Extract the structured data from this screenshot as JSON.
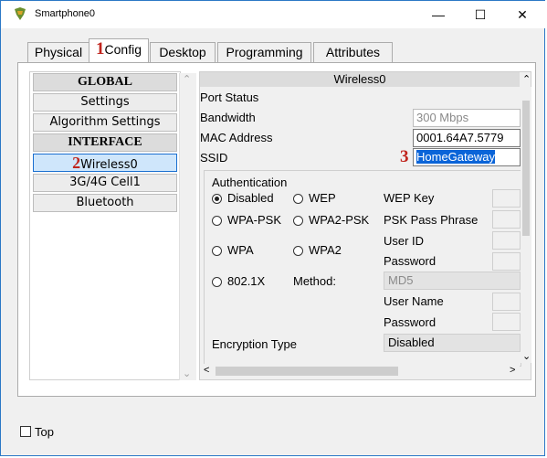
{
  "window": {
    "title": "Smartphone0",
    "minimize": "—",
    "maximize": "☐",
    "close": "✕"
  },
  "tabs": [
    "Physical",
    "Config",
    "Desktop",
    "Programming",
    "Attributes"
  ],
  "sidebar": {
    "items": [
      "GLOBAL",
      "Settings",
      "Algorithm Settings",
      "INTERFACE",
      "Wireless0",
      "3G/4G Cell1",
      "Bluetooth"
    ]
  },
  "annotations": {
    "one": "1",
    "two": "2",
    "three": "3"
  },
  "wireless": {
    "header": "Wireless0",
    "port_status": "Port Status",
    "bandwidth_label": "Bandwidth",
    "bandwidth_value": "300 Mbps",
    "mac_label": "MAC Address",
    "mac_value": "0001.64A7.5779",
    "ssid_label": "SSID",
    "ssid_value": "HomeGateway",
    "auth_label": "Authentication",
    "auth_disabled": "Disabled",
    "auth_wep": "WEP",
    "wep_key": "WEP Key",
    "auth_wpapsk": "WPA-PSK",
    "auth_wpa2psk": "WPA2-PSK",
    "psk_pass": "PSK Pass Phrase",
    "auth_wpa": "WPA",
    "auth_wpa2": "WPA2",
    "user_id": "User ID",
    "password": "Password",
    "auth_8021x": "802.1X",
    "method_label": "Method:",
    "method_value": "MD5",
    "user_name": "User Name",
    "password2": "Password",
    "enc_label": "Encryption Type",
    "enc_value": "Disabled"
  },
  "footer": {
    "top_label": "Top"
  },
  "icons": {
    "up": "⌃",
    "down": "⌄",
    "left": "<",
    "right": ">"
  }
}
